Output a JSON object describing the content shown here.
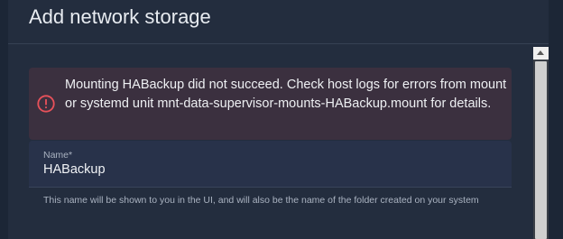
{
  "dialog": {
    "title": "Add network storage"
  },
  "alert": {
    "icon": "error-circle-icon",
    "color": "#e8515a",
    "message": "Mounting HABackup did not succeed. Check host logs for errors from mount or systemd unit mnt-data-supervisor-mounts-HABackup.mount for details."
  },
  "name_field": {
    "label": "Name*",
    "value": "HABackup",
    "helper": "This name will be shown to you in the UI, and will also be the name of the folder created on your system"
  }
}
